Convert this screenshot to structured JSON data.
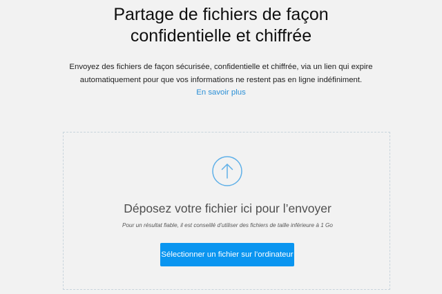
{
  "hero": {
    "title_line1": "Partage de fichiers de façon",
    "title_line2": "confidentielle et chiffrée",
    "description_line1": "Envoyez des fichiers de façon sécurisée, confidentielle et chiffrée, via un lien qui expire",
    "description_line2": "automatiquement pour que vos informations ne restent pas en ligne indéfiniment.",
    "learn_more": "En savoir plus"
  },
  "dropzone": {
    "icon": "upload-arrow-icon",
    "title": "Déposez votre fichier ici pour l’envoyer",
    "hint": "Pour un résultat fiable, il est conseillé d’utiliser des fichiers de taille inférieure à 1 Go",
    "select_button": "Sélectionner un fichier sur l’ordinateur"
  },
  "colors": {
    "background": "#f2f2f2",
    "accent": "#0a95f0",
    "link": "#2a8fd6",
    "icon": "#5fb0e8",
    "dashed_border": "#c8d4dc"
  }
}
